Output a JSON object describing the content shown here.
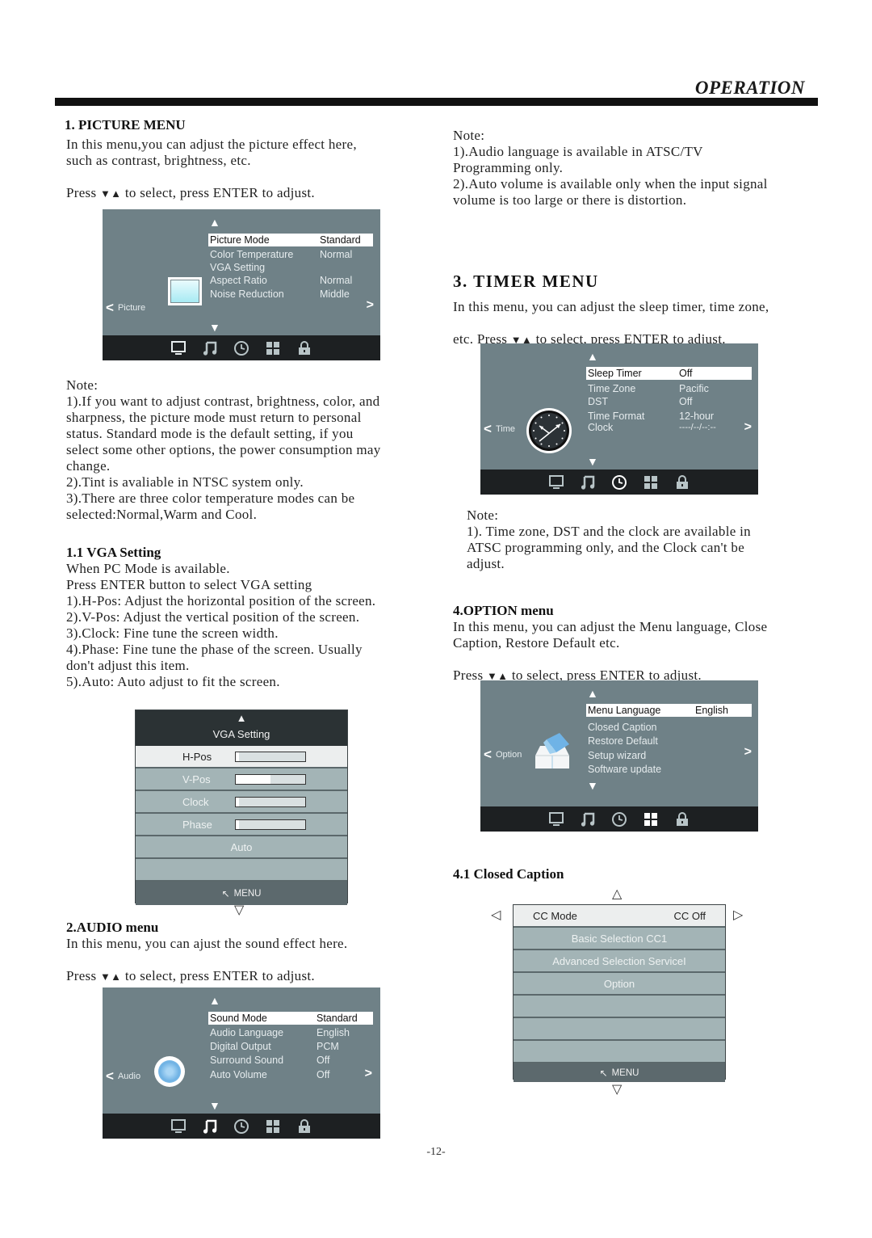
{
  "header": {
    "title": "OPERATION"
  },
  "picture": {
    "heading": "1. PICTURE MENU",
    "intro": "In this menu,you can adjust the picture effect here,\nsuch as contrast, brightness, etc.",
    "press_pre": "Press ",
    "press_post": " to select, press ENTER to adjust.",
    "osd": {
      "side_label": "Picture",
      "items": [
        {
          "label": "Picture Mode",
          "value": "Standard",
          "selected": true
        },
        {
          "label": "Color Temperature",
          "value": "Normal"
        },
        {
          "label": "VGA Setting",
          "value": ""
        },
        {
          "label": "Aspect Ratio",
          "value": "Normal"
        },
        {
          "label": "Noise Reduction",
          "value": "Middle"
        }
      ],
      "active_tab": "picture"
    },
    "note_title": "Note:",
    "notes": "1).If you want to adjust contrast, brightness, color, and\nsharpness, the picture mode must return to personal\nstatus. Standard mode is the default setting, if you\nselect some other options, the power consumption may\nchange.\n2).Tint is avaliable in NTSC system only.\n3).There are three color temperature modes can be\nselected:Normal,Warm and Cool."
  },
  "vga": {
    "heading": "1.1 VGA Setting",
    "body": "When PC Mode is available.\nPress ENTER button to select VGA setting\n1).H-Pos: Adjust the horizontal position of the screen.\n2).V-Pos: Adjust the vertical position of the screen.\n3).Clock: Fine tune the screen width.\n4).Phase: Fine tune the phase of the screen. Usually\ndon't adjust this item.\n5).Auto: Auto adjust to fit the screen.",
    "menu": {
      "title": "VGA Setting",
      "sliders": [
        {
          "label": "H-Pos",
          "value_fraction": 0.05,
          "selected": true
        },
        {
          "label": "V-Pos",
          "value_fraction": 0.5
        },
        {
          "label": "Clock",
          "value_fraction": 0.05
        },
        {
          "label": "Phase",
          "value_fraction": 0.05
        }
      ],
      "auto_label": "Auto",
      "footer": "MENU"
    }
  },
  "audio": {
    "heading": "2.AUDIO menu",
    "intro": "In this menu, you can ajust the sound effect here.",
    "press_pre": "Press ",
    "press_post": " to select, press ENTER to adjust.",
    "osd": {
      "side_label": "Audio",
      "items": [
        {
          "label": "Sound Mode",
          "value": "Standard",
          "selected": true
        },
        {
          "label": "Audio Language",
          "value": "English"
        },
        {
          "label": "Digital Output",
          "value": "PCM"
        },
        {
          "label": "Surround Sound",
          "value": "Off"
        },
        {
          "label": "Auto Volume",
          "value": "Off"
        }
      ],
      "active_tab": "audio"
    },
    "note_title": "Note:",
    "notes": "1).Audio language is available in ATSC/TV\nProgramming only.\n2).Auto volume is available only when the input signal\nvolume is too large or there is distortion."
  },
  "timer": {
    "heading": "3. TIMER  MENU",
    "intro": "In this menu, you can adjust the sleep timer, time zone,",
    "press_pre": "etc. Press ",
    "press_post": " to select, press ENTER to adjust.",
    "osd": {
      "side_label": "Time",
      "items": [
        {
          "label": "Sleep Timer",
          "value": "Off",
          "selected": true
        },
        {
          "label": "Time Zone",
          "value": "Pacific"
        },
        {
          "label": "DST",
          "value": "Off"
        },
        {
          "label": "Time Format",
          "value": "12-hour"
        },
        {
          "label": "Clock",
          "value": "----/--/--:--"
        }
      ],
      "active_tab": "time"
    },
    "note_title": "Note:",
    "notes": "1). Time zone, DST and the clock are available in\nATSC programming only, and the Clock can't be\nadjust."
  },
  "option": {
    "heading": "4.OPTION menu",
    "intro": "In this menu, you can adjust the Menu language, Close\nCaption, Restore Default etc.",
    "press_pre": "Press ",
    "press_post": " to select, press ENTER to adjust.",
    "osd": {
      "side_label": "Option",
      "items": [
        {
          "label": "Menu Language",
          "value": "English",
          "selected": true
        },
        {
          "label": "Closed Caption",
          "value": ""
        },
        {
          "label": "Restore Default",
          "value": ""
        },
        {
          "label": "Setup wizard",
          "value": ""
        },
        {
          "label": "Software update",
          "value": ""
        }
      ],
      "active_tab": "option"
    }
  },
  "cc": {
    "heading": "4.1 Closed Caption",
    "menu": {
      "mode_label": "CC Mode",
      "mode_value": "CC Off",
      "rows": [
        "Basic Selection CC1",
        "Advanced Selection ServiceI",
        "Option",
        "",
        "",
        ""
      ],
      "footer": "MENU"
    }
  },
  "glyphs": {
    "down_up": "▼▲",
    "up": "▲",
    "down": "▼",
    "left": "<",
    "right": ">"
  },
  "page_number": "-12-"
}
